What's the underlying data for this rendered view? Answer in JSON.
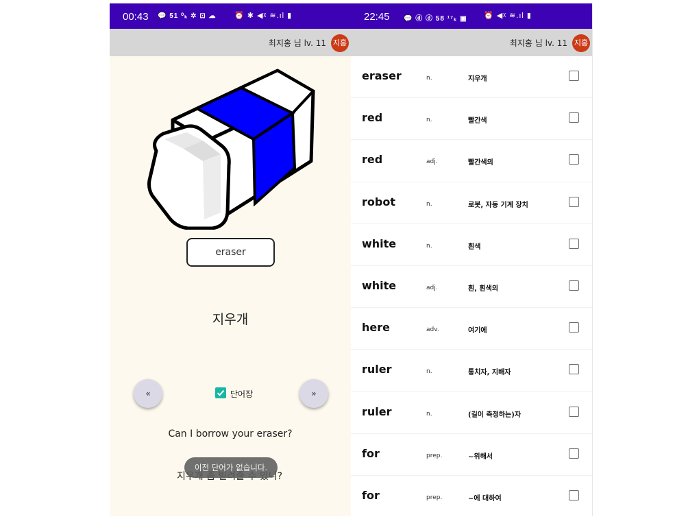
{
  "left_phone": {
    "status": {
      "time": "00:43",
      "extra": "💬 51 ⁰ₖ ✲ ⊡ ☁",
      "right": "⏰ ✱ ◀ᵡ ≋.ıl ▮"
    },
    "header": {
      "user_label": "최지홍 님 lv. 11",
      "avatar": "지홍"
    },
    "card": {
      "word": "eraser",
      "meaning": "지우개",
      "prev_label": "«",
      "next_label": "»",
      "vocab_label": "단어장",
      "vocab_checked": true,
      "example_en": "Can I borrow your eraser?",
      "example_ko": "지우개 좀 빌려줄 수 있니?",
      "toast": "이전 단어가 없습니다."
    }
  },
  "right_phone": {
    "status": {
      "time": "22:45",
      "extra": "💬 ⓓ ⓓ 58 ¹⁷ₖ ▣",
      "right": "⏰ ◀ᵡ ≋.ıl ▮"
    },
    "header": {
      "user_label": "최지홍 님 lv. 11",
      "avatar": "지홍"
    },
    "words": [
      {
        "word": "eraser",
        "pos": "n.",
        "meaning": "지우개",
        "checked": false
      },
      {
        "word": "red",
        "pos": "n.",
        "meaning": "빨간색",
        "checked": false
      },
      {
        "word": "red",
        "pos": "adj.",
        "meaning": "빨간색의",
        "checked": false
      },
      {
        "word": "robot",
        "pos": "n.",
        "meaning": "로봇, 자동 기계 장치",
        "checked": false
      },
      {
        "word": "white",
        "pos": "n.",
        "meaning": "흰색",
        "checked": false
      },
      {
        "word": "white",
        "pos": "adj.",
        "meaning": "흰, 흰색의",
        "checked": false
      },
      {
        "word": "here",
        "pos": "adv.",
        "meaning": "여기에",
        "checked": false
      },
      {
        "word": "ruler",
        "pos": "n.",
        "meaning": "통치자, 지배자",
        "checked": false
      },
      {
        "word": "ruler",
        "pos": "n.",
        "meaning": "(길이 측정하는)자",
        "checked": false
      },
      {
        "word": "for",
        "pos": "prep.",
        "meaning": "~위해서",
        "checked": false
      },
      {
        "word": "for",
        "pos": "prep.",
        "meaning": "~에 대하여",
        "checked": false
      }
    ]
  },
  "colors": {
    "status_bar": "#3d02b4",
    "header_bar": "#d6d6d6",
    "avatar": "#cc3a16",
    "card_background": "#fdf9ee",
    "checkbox_accent": "#16b8a4",
    "eraser_sleeve": "#0000ff"
  },
  "icons": [
    "chat-icon",
    "alarm-icon",
    "bluetooth-icon",
    "mute-icon",
    "wifi-icon",
    "signal-icon",
    "battery-icon",
    "eraser-illustration",
    "check-icon"
  ]
}
